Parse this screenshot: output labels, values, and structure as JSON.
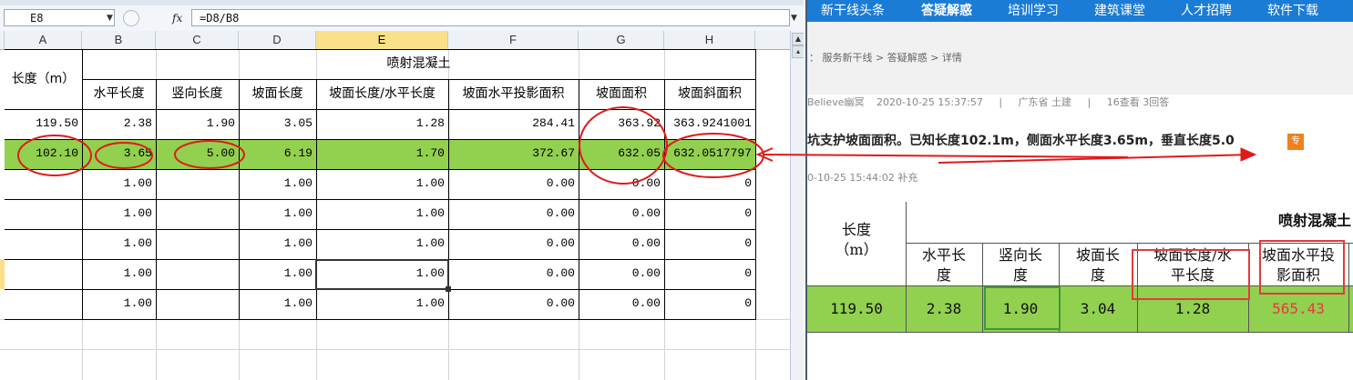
{
  "excel": {
    "name_box": "E8",
    "formula": "=D8/B8",
    "column_headers": [
      "A",
      "B",
      "C",
      "D",
      "E",
      "F",
      "G",
      "H"
    ],
    "selected_column": "E",
    "header": {
      "length_label": "长度（m）",
      "group_label": "喷射混凝土",
      "sub_headers": [
        "水平长度",
        "竖向长度",
        "坡面长度",
        "坡面长度/水平长度",
        "坡面水平投影面积",
        "坡面面积",
        "坡面斜面积"
      ]
    },
    "rows": [
      [
        "119.50",
        "2.38",
        "1.90",
        "3.05",
        "1.28",
        "284.41",
        "363.92",
        "363.9241001"
      ],
      [
        "102.10",
        "3.65",
        "5.00",
        "6.19",
        "1.70",
        "372.67",
        "632.05",
        "632.0517797"
      ],
      [
        "",
        "1.00",
        "",
        "1.00",
        "1.00",
        "0.00",
        "0.00",
        "0"
      ],
      [
        "",
        "1.00",
        "",
        "1.00",
        "1.00",
        "0.00",
        "0.00",
        "0"
      ],
      [
        "",
        "1.00",
        "",
        "1.00",
        "1.00",
        "0.00",
        "0.00",
        "0"
      ],
      [
        "",
        "1.00",
        "",
        "1.00",
        "1.00",
        "0.00",
        "0.00",
        "0"
      ],
      [
        "",
        "1.00",
        "",
        "1.00",
        "1.00",
        "0.00",
        "0.00",
        "0"
      ]
    ]
  },
  "web": {
    "nav": [
      "新干线头条",
      "答疑解惑",
      "培训学习",
      "建筑课堂",
      "人才招聘",
      "软件下载"
    ],
    "nav_active": "答疑解惑",
    "breadcrumb": "：  服务新干线 > 答疑解惑 > 详情",
    "meta": {
      "user": "Believe幽冥",
      "datetime": "2020-10-25 15:37:57",
      "sep": "|",
      "location": "广东省 土建",
      "stats": "16查看 3回答"
    },
    "question_title": "坑支护坡面面积。已知长度102.1m，侧面水平长度3.65m，垂直长度5.0",
    "badge": "专",
    "supplement": "0-10-25 15:44:02 补充",
    "table": {
      "length_label_1": "长度",
      "length_label_2": "（m）",
      "group_label": "喷射混凝土",
      "sub_headers": [
        [
          "水平长",
          "度"
        ],
        [
          "竖向长",
          "度"
        ],
        [
          "坡面长",
          "度"
        ],
        [
          "坡面长度/水",
          "平长度"
        ],
        [
          "坡面水平投",
          "影面积"
        ]
      ],
      "row": [
        "119.50",
        "2.38",
        "1.90",
        "3.04",
        "1.28",
        "565.43"
      ],
      "highlight_color": "#e23b3b"
    }
  }
}
